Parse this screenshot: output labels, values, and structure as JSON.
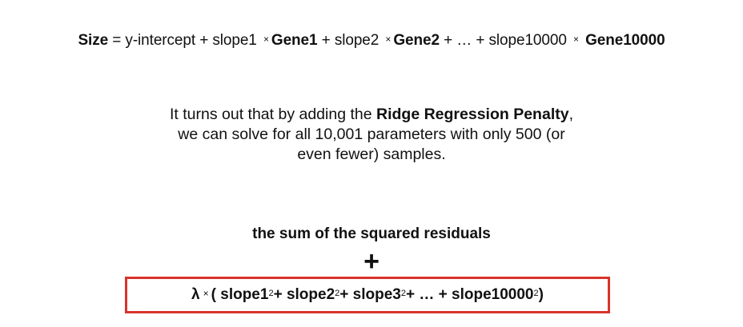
{
  "equation": {
    "size": "Size",
    "eq_intercept": " = y-intercept + slope1 ",
    "times": "×",
    "gene1": "Gene1",
    "plus_slope2": " + slope2 ",
    "gene2": "Gene2",
    "ellipsis_slope10000": " + … + slope10000 ",
    "gene10000": "Gene10000"
  },
  "explanation": {
    "prefix": "It turns out that by adding the ",
    "emphasis": "Ridge Regression Penalty",
    "suffix": ",",
    "line2": "we can solve for all 10,001 parameters with only 500 (or",
    "line3": "even fewer) samples."
  },
  "penalty": {
    "heading": "the sum of the squared residuals",
    "plus": "+",
    "lambda": "λ",
    "times": "×",
    "open": "( slope1",
    "t1_exp": "2",
    "t2": " + slope2",
    "t2_exp": "2",
    "t3": " + slope3",
    "t3_exp": "2",
    "t4": " + … + slope10000",
    "t4_exp": "2",
    "close": " )",
    "box_color": "#d8332a"
  }
}
